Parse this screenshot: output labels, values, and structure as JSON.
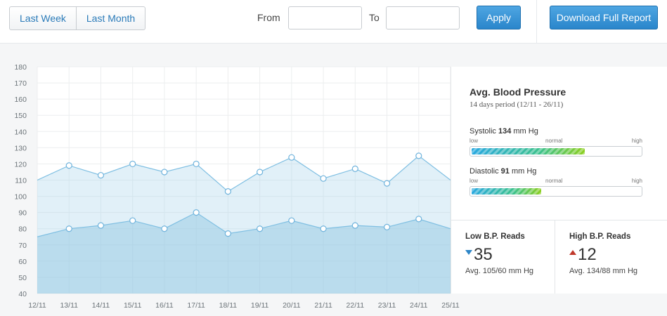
{
  "toolbar": {
    "range_buttons": [
      "Last Week",
      "Last Month"
    ],
    "from_label": "From",
    "to_label": "To",
    "from_value": "",
    "to_value": "",
    "apply_label": "Apply",
    "download_label": "Download Full Report"
  },
  "chart_data": {
    "type": "area",
    "categories": [
      "12/11",
      "13/11",
      "14/11",
      "15/11",
      "16/11",
      "17/11",
      "18/11",
      "19/11",
      "20/11",
      "21/11",
      "22/11",
      "23/11",
      "24/11",
      "25/11"
    ],
    "series": [
      {
        "name": "Systolic",
        "values": [
          110,
          119,
          113,
          120,
          115,
          120,
          103,
          115,
          124,
          111,
          117,
          108,
          125,
          110
        ],
        "color": "#a9d3ea"
      },
      {
        "name": "Diastolic",
        "values": [
          75,
          80,
          82,
          85,
          80,
          90,
          77,
          80,
          85,
          80,
          82,
          81,
          86,
          80
        ],
        "color": "#8cc3e0"
      }
    ],
    "ylim": [
      40,
      180
    ],
    "yticks": [
      40,
      50,
      60,
      70,
      80,
      90,
      100,
      110,
      120,
      130,
      140,
      150,
      160,
      170,
      180
    ],
    "grid": true
  },
  "summary": {
    "title": "Avg. Blood Pressure",
    "period": "14 days period (12/11 - 26/11)",
    "unit": "mm Hg",
    "scale_labels": {
      "low": "low",
      "normal": "normal",
      "high": "high"
    },
    "systolic": {
      "label": "Systolic",
      "value": "134",
      "level": 0.66
    },
    "diastolic": {
      "label": "Diastolic",
      "value": "91",
      "level": 0.405
    }
  },
  "stats": {
    "low": {
      "title": "Low B.P. Reads",
      "count": "35",
      "avg": "Avg. 105/60 mm Hg"
    },
    "high": {
      "title": "High B.P. Reads",
      "count": "12",
      "avg": "Avg. 134/88 mm Hg"
    }
  },
  "colors": {
    "accent": "#2a86cb",
    "low_arrow": "#2e86c8",
    "high_arrow": "#c0392b"
  }
}
